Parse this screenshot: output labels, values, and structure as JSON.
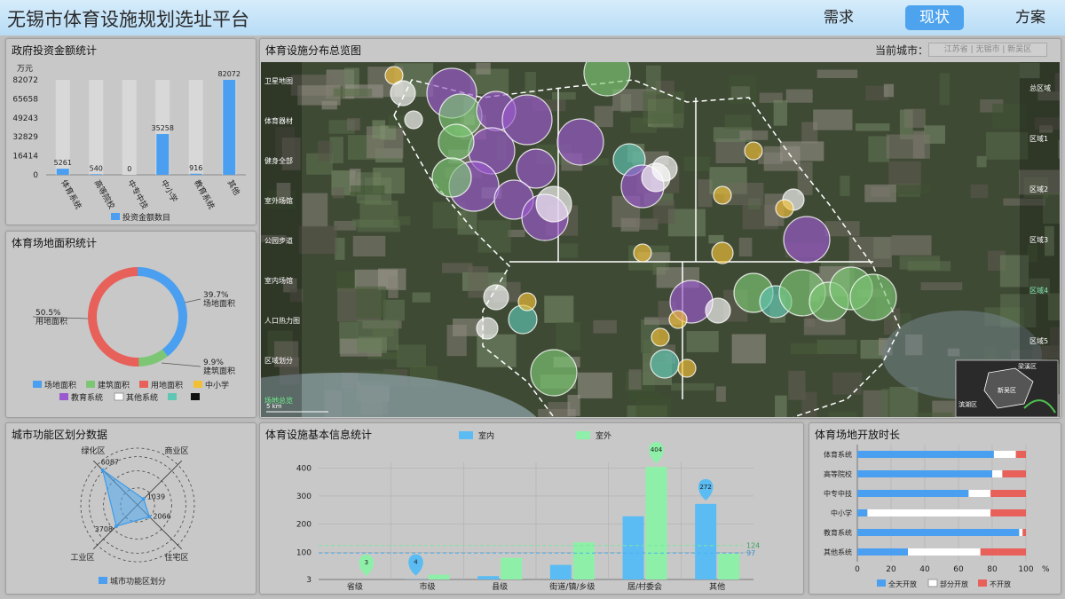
{
  "app": {
    "title": "无锡市体育设施规划选址平台"
  },
  "nav": [
    {
      "label": "需求"
    },
    {
      "label": "现状"
    },
    {
      "label": "方案"
    }
  ],
  "panels": {
    "investment": {
      "title": "政府投资金额统计"
    },
    "area": {
      "title": "体育场地面积统计"
    },
    "zones": {
      "title": "城市功能区划分数据"
    },
    "map": {
      "title": "体育设施分布总览图",
      "city_label": "当前城市：",
      "city_value": "江苏省 | 无锡市 | 新吴区"
    },
    "facilities": {
      "title": "体育设施基本信息统计"
    },
    "hours": {
      "title": "体育场地开放时长"
    }
  },
  "map": {
    "left_menu": [
      "卫星地图",
      "体育器材",
      "健身全部",
      "室外场馆",
      "公园步道",
      "室内场馆",
      "人口热力图",
      "区域划分",
      "场地总览"
    ],
    "right_menu": [
      "总区域",
      "区域1",
      "区域2",
      "区域3",
      "区域4",
      "区域5"
    ],
    "scale": "5 km",
    "inset_labels": [
      "梁溪区",
      "新吴区",
      "滨湖区"
    ]
  },
  "colors": {
    "blue": "#4a9ff0",
    "green": "#7dc774",
    "red": "#e8605a",
    "yellow": "#f2c037",
    "purple": "#9b59d0",
    "white": "#ffffff",
    "teal": "#5fc6b4",
    "black": "#111111",
    "outdoor": "#8ef0a8",
    "indoor": "#5bbcf3"
  },
  "chart_data": [
    {
      "type": "bar",
      "unit": "万元",
      "categories": [
        "体育系统",
        "高等院校",
        "中专中技",
        "中小学",
        "教育系统",
        "其他"
      ],
      "series": [
        {
          "name": "投资金额数目",
          "values": [
            5261,
            540,
            0,
            35258,
            916,
            82072
          ]
        }
      ],
      "yticks": [
        0,
        16414,
        32829,
        49243,
        65658,
        82072
      ],
      "ylim": [
        0,
        82072
      ],
      "legend": "bottom"
    },
    {
      "type": "pie",
      "slices": [
        {
          "name": "场地面积",
          "value": 39.7,
          "label": "39.7%",
          "sub": "场地面积",
          "color": "#4a9ff0"
        },
        {
          "name": "建筑面积",
          "value": 9.9,
          "label": "9.9%",
          "sub": "建筑面积",
          "color": "#7dc774"
        },
        {
          "name": "用地面积",
          "value": 50.5,
          "label": "50.5%",
          "sub": "用地面积",
          "color": "#e8605a"
        }
      ],
      "legend": [
        {
          "name": "场地面积",
          "color": "#4a9ff0"
        },
        {
          "name": "建筑面积",
          "color": "#7dc774"
        },
        {
          "name": "用地面积",
          "color": "#e8605a"
        },
        {
          "name": "中小学",
          "color": "#f2c037"
        },
        {
          "name": "教育系统",
          "color": "#9b59d0"
        },
        {
          "name": "其他系统",
          "color": "#ffffff"
        },
        {
          "name": "",
          "color": "#5fc6b4"
        },
        {
          "name": "",
          "color": "#111111"
        }
      ]
    },
    {
      "type": "radar",
      "axes": [
        "绿化区",
        "商业区",
        "住宅区",
        "工业区"
      ],
      "series": [
        {
          "name": "城市功能区划分",
          "values": [
            6087,
            1039,
            2066,
            3708
          ]
        }
      ],
      "max": 7000,
      "legend": "bottom"
    },
    {
      "type": "bar",
      "categories": [
        "省级",
        "市级",
        "县级",
        "街道/镇/乡级",
        "居/村委会",
        "其他"
      ],
      "series": [
        {
          "name": "室内",
          "values": [
            3,
            4,
            15,
            55,
            228,
            272
          ]
        },
        {
          "name": "室外",
          "values": [
            3,
            20,
            80,
            135,
            404,
            95
          ]
        }
      ],
      "yticks": [
        3,
        100,
        200,
        300,
        400
      ],
      "ylim": [
        3,
        420
      ],
      "pins": [
        {
          "category": "省级",
          "value": 3,
          "series": "室外"
        },
        {
          "category": "市级",
          "value": 4,
          "series": "室内"
        },
        {
          "category": "居/村委会",
          "value": 404,
          "series": "室外"
        },
        {
          "category": "其他",
          "value": 272,
          "series": "室内"
        }
      ],
      "marklines": [
        {
          "value": 124,
          "label": "124"
        },
        {
          "value": 97,
          "label": "97"
        }
      ],
      "legend": "top"
    },
    {
      "type": "bar",
      "orientation": "horizontal-stacked",
      "categories": [
        "体育系统",
        "高等院校",
        "中专中技",
        "中小学",
        "教育系统",
        "其他系统"
      ],
      "series": [
        {
          "name": "全天开放",
          "values": [
            81,
            80,
            66,
            6,
            96,
            30
          ],
          "color": "#4a9ff0"
        },
        {
          "name": "部分开放",
          "values": [
            13,
            6,
            13,
            73,
            2,
            43
          ],
          "color": "#ffffff"
        },
        {
          "name": "不开放",
          "values": [
            6,
            14,
            21,
            21,
            2,
            27
          ],
          "color": "#e8605a"
        }
      ],
      "xticks": [
        0,
        20,
        40,
        60,
        80,
        100
      ],
      "xunit": "%",
      "xlim": [
        0,
        100
      ],
      "legend": "bottom"
    }
  ]
}
